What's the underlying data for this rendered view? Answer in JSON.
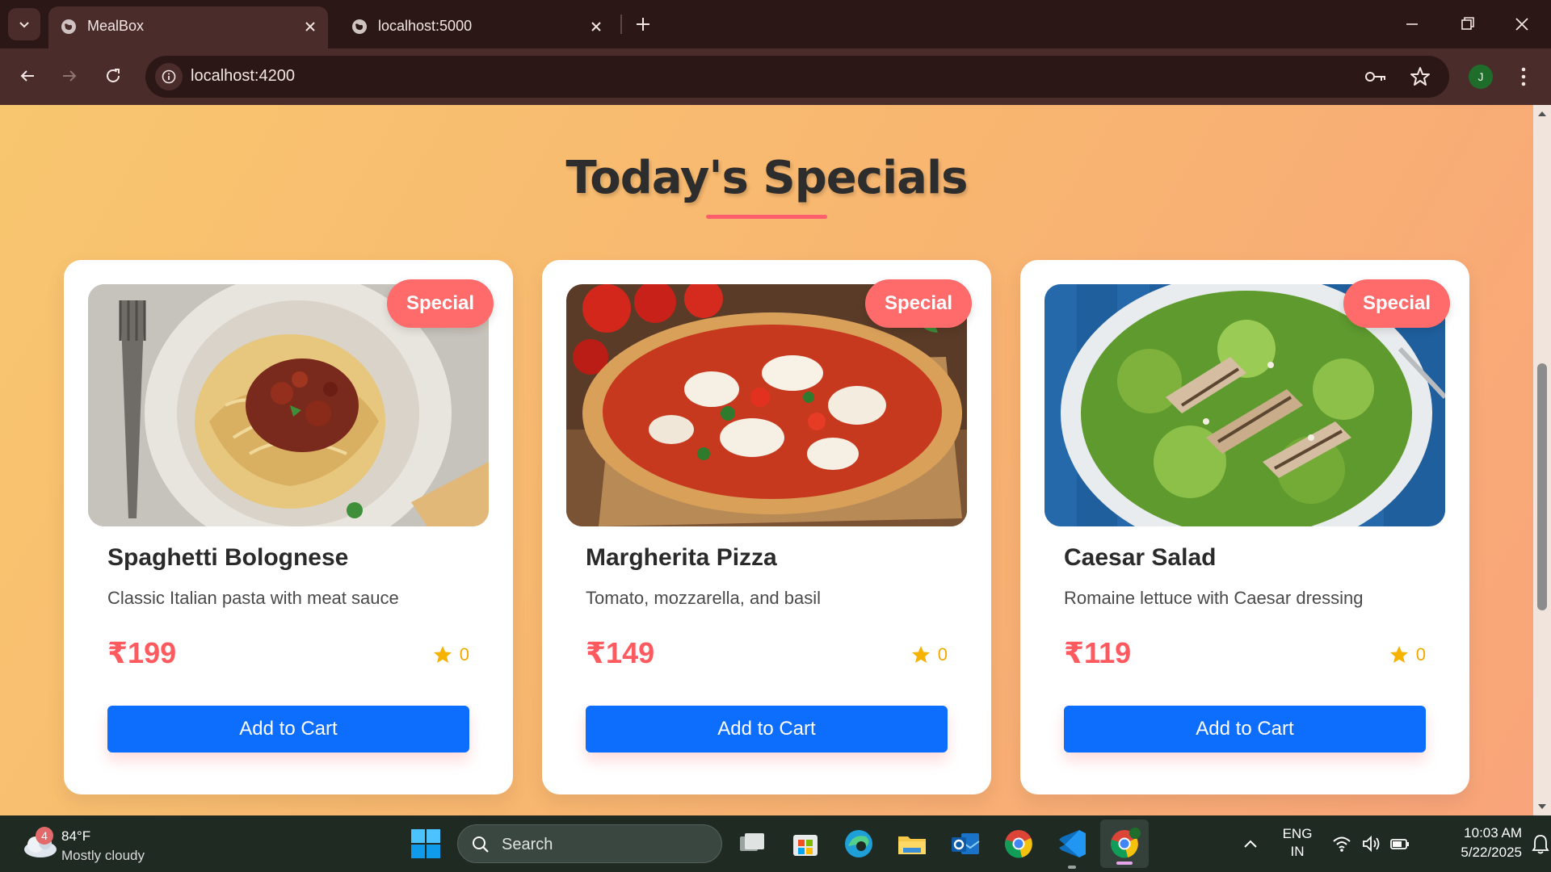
{
  "browser": {
    "tabs": [
      {
        "title": "MealBox",
        "active": true
      },
      {
        "title": "localhost:5000",
        "active": false
      }
    ],
    "url": "localhost:4200",
    "profile_initial": "J"
  },
  "page": {
    "heading": "Today's Specials",
    "cards": [
      {
        "name": "Spaghetti Bolognese",
        "description": "Classic Italian pasta with meat sauce",
        "price": "₹199",
        "rating": "0",
        "badge": "Special",
        "button": "Add to Cart",
        "image": "spaghetti-photo"
      },
      {
        "name": "Margherita Pizza",
        "description": "Tomato, mozzarella, and basil",
        "price": "₹149",
        "rating": "0",
        "badge": "Special",
        "button": "Add to Cart",
        "image": "pizza-photo"
      },
      {
        "name": "Caesar Salad",
        "description": "Romaine lettuce with Caesar dressing",
        "price": "₹119",
        "rating": "0",
        "badge": "Special",
        "button": "Add to Cart",
        "image": "salad-photo"
      }
    ]
  },
  "taskbar": {
    "weather": {
      "badge": "4",
      "temp": "84°F",
      "desc": "Mostly cloudy"
    },
    "search_placeholder": "Search",
    "lang_line1": "ENG",
    "lang_line2": "IN",
    "time": "10:03 AM",
    "date": "5/22/2025"
  },
  "colors": {
    "accent_red": "#ff6b6b",
    "button_blue": "#0d6efd",
    "price_red": "#ff5a5f",
    "star_gold": "#f5a800"
  }
}
